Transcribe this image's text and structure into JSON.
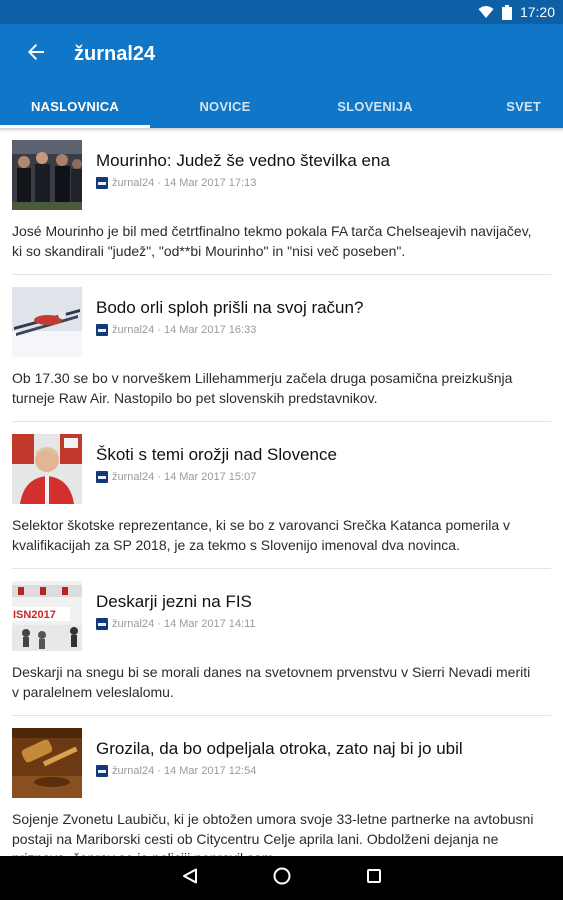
{
  "status_bar": {
    "time": "17:20",
    "icons": [
      "wifi-icon",
      "battery-icon"
    ]
  },
  "app_bar": {
    "title": "žurnal24",
    "back_icon": "arrow-back-icon"
  },
  "colors": {
    "primary": "#1076c7",
    "status_bar": "#0d5fa6",
    "nav_bar": "#000000"
  },
  "tabs": [
    {
      "label": "NASLOVNICA",
      "selected": true
    },
    {
      "label": "NOVICE",
      "selected": false
    },
    {
      "label": "SLOVENIJA",
      "selected": false
    },
    {
      "label": "SVET",
      "selected": false
    }
  ],
  "articles": [
    {
      "title": "Mourinho: Judež še vedno številka ena",
      "meta": "žurnal24 · 14 Mar 2017 17:13",
      "summary": "José Mourinho je bil med četrtfinalno tekmo pokala FA tarča Chelseajevih navijačev, ki so skandirali \"judež\", \"od**bi Mourinho\" in \"nisi več poseben\"."
    },
    {
      "title": "Bodo orli sploh prišli na svoj račun?",
      "meta": "žurnal24 · 14 Mar 2017 16:33",
      "summary": "Ob 17.30 se bo v norveškem Lillehammerju začela druga posamična preizkušnja turneje Raw Air. Nastopilo bo pet slovenskih predstavnikov."
    },
    {
      "title": "Škoti s temi orožji nad Slovence",
      "meta": "žurnal24 · 14 Mar 2017 15:07",
      "summary": "Selektor škotske reprezentance, ki se bo z varovanci Srečka Katanca pomerila v kvalifikacijah za SP 2018, je za tekmo s Slovenijo imenoval dva novinca."
    },
    {
      "title": "Deskarji jezni na FIS",
      "meta": "žurnal24 · 14 Mar 2017 14:11",
      "summary": "Deskarji na snegu bi se morali danes na svetovnem prvenstvu v Sierri Nevadi meriti v paralelnem veleslalomu.",
      "thumb_text": "ISN2017"
    },
    {
      "title": "Grozila, da bo odpeljala otroka, zato naj bi jo ubil",
      "meta": "žurnal24 · 14 Mar 2017 12:54",
      "summary": "Sojenje Zvonetu Laubiču, ki je obtožen umora svoje 33-letne partnerke na avtobusni postaji na Mariborski cesti ob Citycentru Celje aprila lani. Obdolženi dejanja ne priznava, čeprav se je policiji nepravil sam."
    }
  ],
  "nav_bar": {
    "buttons": [
      "back-triangle-icon",
      "home-circle-icon",
      "recents-square-icon"
    ]
  }
}
